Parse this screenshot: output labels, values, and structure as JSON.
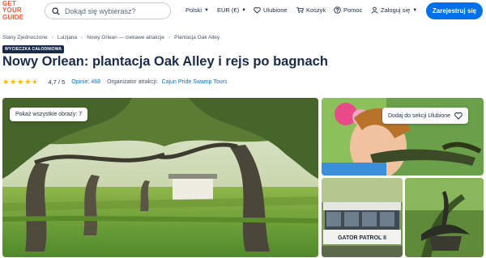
{
  "header": {
    "logo": [
      "GET",
      "YOUR",
      "GUIDE"
    ],
    "search_placeholder": "Dokąd się wybierasz?",
    "language": "Polski",
    "currency": "EUR (€)",
    "wishlist": "Ulubione",
    "cart": "Koszyk",
    "help": "Pomoc",
    "login": "Zaloguj się",
    "signup": "Zarejestruj się"
  },
  "breadcrumb": [
    "Stany Zjednoczone",
    "Luizjana",
    "Nowy Orlean — ciekawe atrakcje",
    "Plantacja Oak Alley"
  ],
  "badge": "WYCIECZKA CAŁODNIOWA",
  "title": "Nowy Orlean: plantacja Oak Alley i rejs po bagnach",
  "rating": {
    "stars": 4.7,
    "score": "4,7 / 5",
    "reviews": "Opinie: 468",
    "organizer_label": "Organizator atrakcji:",
    "organizer_name": "Cajun Pride Swamp Tours"
  },
  "gallery": {
    "show_all": "Pokaż wszystkie obrazy: 7",
    "add_wishlist": "Dodaj do sekcji Ulubione",
    "boat_sign": "GATOR PATROL II"
  },
  "colors": {
    "brand": "#ff5533",
    "accent": "#0071eb",
    "text": "#1a2b49",
    "star": "#ffb400"
  }
}
